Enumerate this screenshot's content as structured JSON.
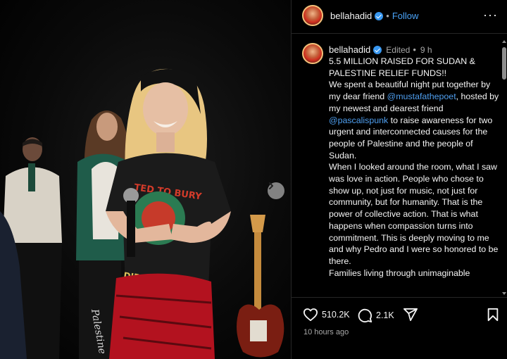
{
  "post": {
    "username": "bellahadid",
    "follow_label": "Follow",
    "dot": "•",
    "more_label": "···"
  },
  "caption": {
    "username": "bellahadid",
    "edited": "Edited",
    "time_short": "9 h",
    "line1": "5.5 MILLION RAISED FOR SUDAN & PALESTINE RELIEF FUNDS!!",
    "p1_a": "We spent a beautiful night put together by my dear friend ",
    "mention1": "@mustafathepoet",
    "p1_b": ", hosted by my newest and dearest friend ",
    "mention2": "@pascalispunk",
    "p1_c": " to raise awareness for two urgent and interconnected causes for the people of Palestine and the people of Sudan.",
    "p2": "When I looked around the room, what I saw was love in action. People who chose to show up, not just for music, not just for community, but for humanity. That is the power of collective action. That is what happens when compassion turns into commitment. This is deeply moving to me and why Pedro and I were so honored to be there.",
    "p3": "Families living through unimaginable"
  },
  "actions": {
    "likes": "510.2K",
    "comments": "2.1K",
    "timestamp": "10 hours ago"
  },
  "photo": {
    "shirt_text_top": "TED TO BURY",
    "shirt_text_bottom": "DIDN'T KNOW",
    "skirt_text": "Palestine"
  },
  "colors": {
    "link": "#4aa3f7",
    "verified": "#3897f0",
    "muted": "#a8a8a8",
    "scarf": "#b3121f"
  }
}
